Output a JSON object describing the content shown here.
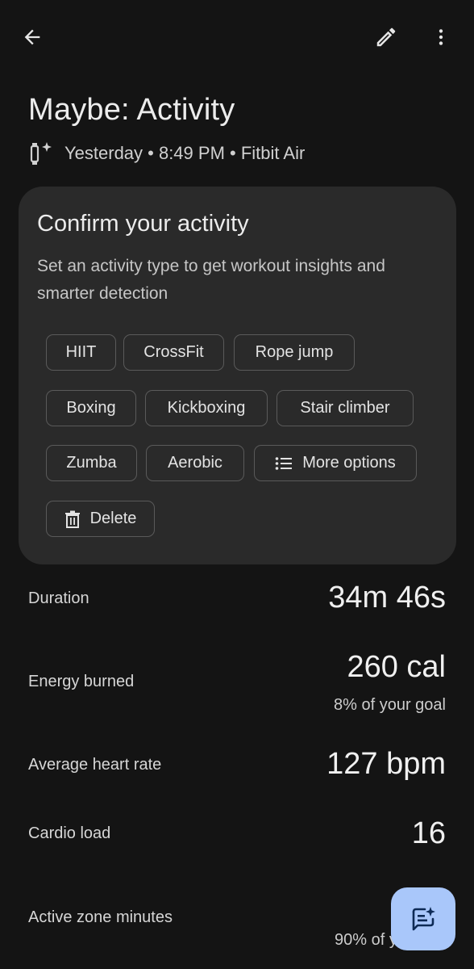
{
  "header": {
    "back_icon": "back-arrow-icon",
    "edit_icon": "pencil-icon",
    "more_icon": "vertical-dots-icon"
  },
  "title": "Maybe: Activity",
  "subtitle": {
    "icon": "tracker-sparkle-icon",
    "text": "Yesterday • 8:49 PM • Fitbit Air"
  },
  "card": {
    "title": "Confirm your activity",
    "description": "Set an activity type to get workout insights and smarter detection",
    "chips": {
      "hiit": "HIIT",
      "crossfit": "CrossFit",
      "rope_jump": "Rope jump",
      "boxing": "Boxing",
      "kickboxing": "Kickboxing",
      "stair_climber": "Stair climber",
      "zumba": "Zumba",
      "aerobic": "Aerobic",
      "more_options": "More options",
      "delete": "Delete"
    }
  },
  "stats": {
    "duration": {
      "label": "Duration",
      "value": "34m 46s"
    },
    "energy": {
      "label": "Energy burned",
      "value": "260 cal",
      "sub": "8% of your goal"
    },
    "heart_rate": {
      "label": "Average heart rate",
      "value": "127 bpm"
    },
    "cardio_load": {
      "label": "Cardio load",
      "value": "16"
    },
    "azm": {
      "label": "Active zone minutes",
      "sub": "90% of yo"
    }
  },
  "fab": {
    "icon": "chat-sparkle-icon"
  },
  "colors": {
    "background": "#141414",
    "card": "#2a2a2a",
    "fab": "#a9c7fa"
  }
}
